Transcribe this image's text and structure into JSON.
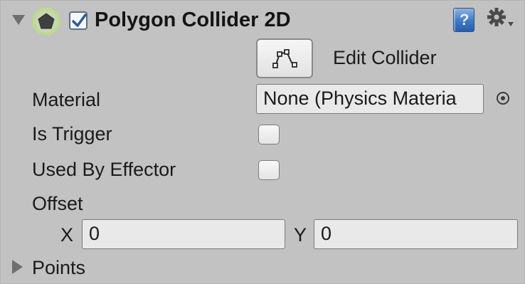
{
  "component": {
    "title": "Polygon Collider 2D",
    "enabled": true,
    "icon": "polygon-collider-icon",
    "help_icon": "help-book-icon",
    "settings_icon": "gear-dropdown-icon"
  },
  "edit_collider": {
    "icon": "edit-polygon-icon",
    "label": "Edit Collider"
  },
  "fields": {
    "material": {
      "label": "Material",
      "value": "None (Physics Materia"
    },
    "is_trigger": {
      "label": "Is Trigger",
      "checked": false
    },
    "used_by_effector": {
      "label": "Used By Effector",
      "checked": false
    },
    "offset": {
      "label": "Offset",
      "x_label": "X",
      "x_value": "0",
      "y_label": "Y",
      "y_value": "0"
    },
    "points": {
      "label": "Points",
      "expanded": false
    }
  },
  "colors": {
    "panel_bg": "#c2c2c2",
    "field_bg": "#e9e9e9",
    "icon_green": "#8fc94a",
    "help_blue": "#3d78c7",
    "checkbox_blue": "#2b5b9a"
  }
}
